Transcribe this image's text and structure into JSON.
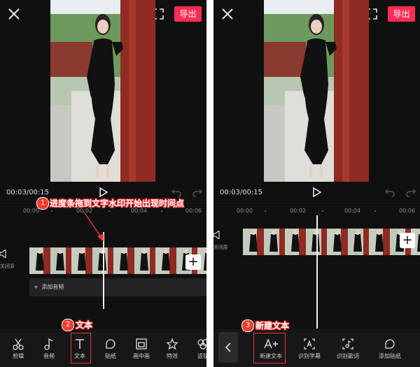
{
  "colors": {
    "accent": "#fe2c55",
    "annotation": "#f23c2e"
  },
  "left": {
    "export_label": "导出",
    "time_display": "00:03/00:15",
    "ruler": [
      "00:00",
      "00:02",
      "00:04",
      "00:06"
    ],
    "audio_muted_label": "关闭原声",
    "add_audio_label": "添加音频",
    "toolbar": [
      {
        "label": "剪辑",
        "icon": "scissors-icon"
      },
      {
        "label": "音频",
        "icon": "music-note-icon"
      },
      {
        "label": "文本",
        "icon": "text-icon",
        "highlighted": true
      },
      {
        "label": "贴纸",
        "icon": "sticker-icon"
      },
      {
        "label": "画中画",
        "icon": "picture-in-picture-icon"
      },
      {
        "label": "特效",
        "icon": "effects-star-icon"
      },
      {
        "label": "滤镜",
        "icon": "filter-icon"
      }
    ],
    "annotation_1": {
      "number": "1",
      "text": "进度条拖到文字水印开始出现时间点"
    },
    "annotation_2": {
      "number": "2",
      "text": "文本"
    }
  },
  "right": {
    "export_label": "导出",
    "time_display": "00:03/00:15",
    "ruler": [
      "00:00",
      "00:02",
      "00:04",
      "00:06"
    ],
    "audio_muted_label": "关闭原声",
    "toolbar": [
      {
        "label": "新建文本",
        "icon": "add-text-icon",
        "highlighted": true
      },
      {
        "label": "识别字幕",
        "icon": "recognize-subtitle-icon"
      },
      {
        "label": "识别歌词",
        "icon": "recognize-lyrics-icon"
      },
      {
        "label": "添加贴纸",
        "icon": "add-sticker-icon"
      }
    ],
    "annotation_3": {
      "number": "3",
      "text": "新建文本"
    }
  }
}
